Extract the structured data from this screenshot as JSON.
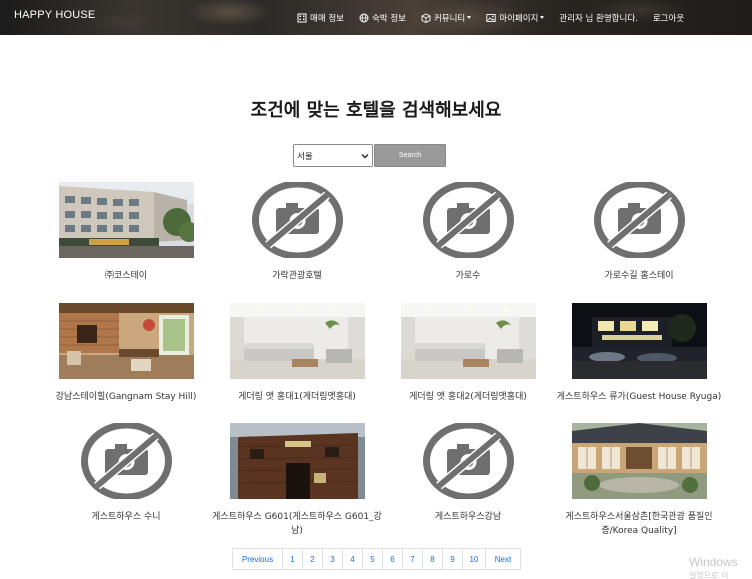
{
  "navbar": {
    "brand": "HAPPY HOUSE",
    "items": [
      {
        "label": "매매 정보",
        "icon": "building-icon",
        "dropdown": false
      },
      {
        "label": "숙박 정보",
        "icon": "globe-icon",
        "dropdown": false
      },
      {
        "label": "커뮤니티",
        "icon": "box-icon",
        "dropdown": true
      },
      {
        "label": "마이페이지",
        "icon": "image-icon",
        "dropdown": true
      },
      {
        "label": "관리자 님 환영합니다.",
        "icon": "",
        "dropdown": false
      },
      {
        "label": "로그아웃",
        "icon": "",
        "dropdown": false
      }
    ]
  },
  "main": {
    "heading": "조건에 맞는 호텔을 검색해보세요",
    "search": {
      "selected_city": "서울",
      "button_label": "Search"
    }
  },
  "hotels": [
    {
      "name": "㈜코스테이",
      "photo": "building"
    },
    {
      "name": "가락관광호텔",
      "photo": "no-photo"
    },
    {
      "name": "가로수",
      "photo": "no-photo"
    },
    {
      "name": "가로수길 홈스테이",
      "photo": "no-photo"
    },
    {
      "name": "강남스테이힐(Gangnam Stay Hill)",
      "photo": "cafe"
    },
    {
      "name": "게더링 앳 홍대1(게더링앳홍대)",
      "photo": "livingroom"
    },
    {
      "name": "게더링 앳 홍대2(게더링앳홍대)",
      "photo": "livingroom"
    },
    {
      "name": "게스트하우스 류가(Guest House Ryuga)",
      "photo": "night"
    },
    {
      "name": "게스트하우스 수니",
      "photo": "no-photo"
    },
    {
      "name": "게스트하우스 G601(게스트하우스 G601_강남)",
      "photo": "brick"
    },
    {
      "name": "게스트하우스강남",
      "photo": "no-photo"
    },
    {
      "name": "게스트하우스서울삼촌[한국관광 품질인증/Korea Quality]",
      "photo": "hanok"
    }
  ],
  "pagination": {
    "previous": "Previous",
    "pages": [
      "1",
      "2",
      "3",
      "4",
      "5",
      "6",
      "7",
      "8",
      "9",
      "10"
    ],
    "next": "Next"
  },
  "watermark": {
    "title": "Windows",
    "subtitle": "설정으로 이"
  }
}
